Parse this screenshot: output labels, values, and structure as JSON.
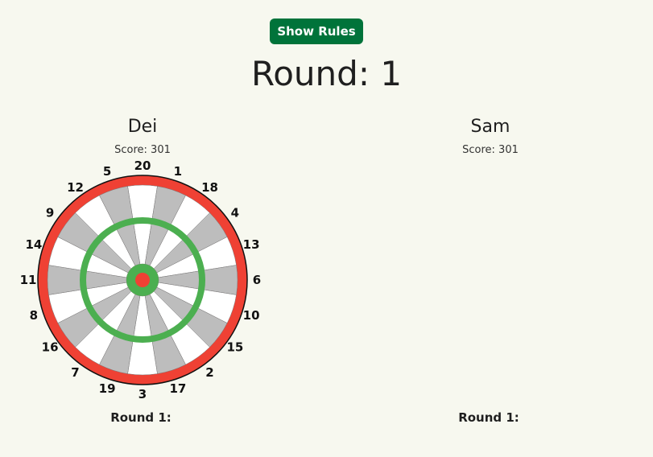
{
  "header": {
    "rules_button_label": "Show Rules",
    "round_title": "Round: 1"
  },
  "players": [
    {
      "name": "Dei",
      "score_text": "Score: 301",
      "round_text": "Round 1:"
    },
    {
      "name": "Sam",
      "score_text": "Score: 301",
      "round_text": "Round 1:"
    }
  ],
  "board": {
    "numbers": [
      "20",
      "1",
      "18",
      "4",
      "13",
      "6",
      "10",
      "15",
      "2",
      "17",
      "3",
      "19",
      "7",
      "16",
      "8",
      "11",
      "14",
      "9",
      "12",
      "5"
    ],
    "colors": {
      "double_ring": "#ef4134",
      "treble_ring": "#4caf50",
      "outer_bull": "#4caf50",
      "inner_bull": "#ef4134",
      "dark_segment": "#bdbdbd",
      "light_segment": "#ffffff",
      "accent_button": "#00733a"
    }
  }
}
